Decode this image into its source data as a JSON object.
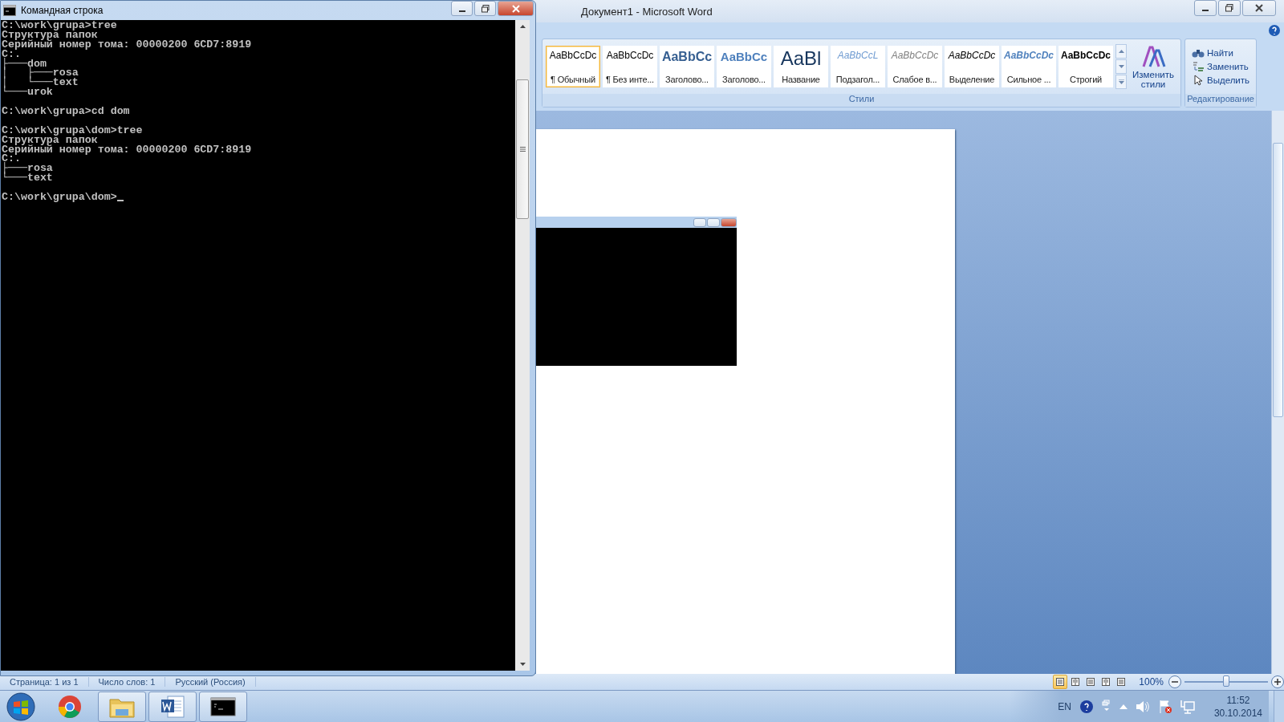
{
  "console": {
    "title": "Командная строка",
    "blocks": [
      [
        "C:\\work\\grupa>tree",
        "Структура папок",
        "Серийный номер тома: 00000200 6CD7:8919",
        "C:.",
        "├───dom",
        "│   ├───rosa",
        "│   └───text",
        "└───urok"
      ],
      [
        "C:\\work\\grupa>cd dom"
      ],
      [
        "C:\\work\\grupa\\dom>tree",
        "Структура папок",
        "Серийный номер тома: 00000200 6CD7:8919",
        "C:.",
        "├───rosa",
        "└───text"
      ],
      [
        "C:\\work\\grupa\\dom>"
      ]
    ]
  },
  "word": {
    "title": "Документ1 - Microsoft Word",
    "styles": [
      {
        "kind": "normal",
        "preview": "AaBbCcDc",
        "label": "¶ Обычный",
        "selected": true
      },
      {
        "kind": "no_spacing",
        "preview": "AaBbCcDc",
        "label": "¶ Без инте...",
        "selected": false
      },
      {
        "kind": "heading1",
        "preview": "AaBbCc",
        "label": "Заголово...",
        "selected": false
      },
      {
        "kind": "heading2",
        "preview": "AaBbCc",
        "label": "Заголово...",
        "selected": false
      },
      {
        "kind": "title",
        "preview": "AaBl",
        "label": "Название",
        "selected": false
      },
      {
        "kind": "subtitle",
        "preview": "AaBbCcL",
        "label": "Подзагол...",
        "selected": false
      },
      {
        "kind": "subtle",
        "preview": "AaBbCcDc",
        "label": "Слабое в...",
        "selected": false
      },
      {
        "kind": "emphasis",
        "preview": "AaBbCcDc",
        "label": "Выделение",
        "selected": false
      },
      {
        "kind": "intense",
        "preview": "AaBbCcDc",
        "label": "Сильное ...",
        "selected": false
      },
      {
        "kind": "strong",
        "preview": "AaBbCcDc",
        "label": "Строгий",
        "selected": false
      }
    ],
    "change_styles": "Изменить стили",
    "styles_group": "Стили",
    "editing": [
      {
        "kind": "find",
        "label": "Найти"
      },
      {
        "kind": "replace",
        "label": "Заменить"
      },
      {
        "kind": "select",
        "label": "Выделить"
      }
    ],
    "editing_group": "Редактирование",
    "status": [
      "Страница: 1 из 1",
      "Число слов: 1",
      "Русский (Россия)"
    ],
    "views": [
      {
        "selected": true
      },
      {
        "selected": false
      },
      {
        "selected": false
      },
      {
        "selected": false
      },
      {
        "selected": false
      }
    ],
    "zoom": {
      "label": "100%",
      "level": 0.5
    }
  },
  "taskbar": {
    "apps": [
      {
        "kind": "start"
      },
      {
        "kind": "chrome"
      },
      {
        "kind": "explorer"
      },
      {
        "kind": "word"
      },
      {
        "kind": "console"
      }
    ],
    "language": "EN",
    "time": "11:52",
    "date": "30.10.2014"
  }
}
